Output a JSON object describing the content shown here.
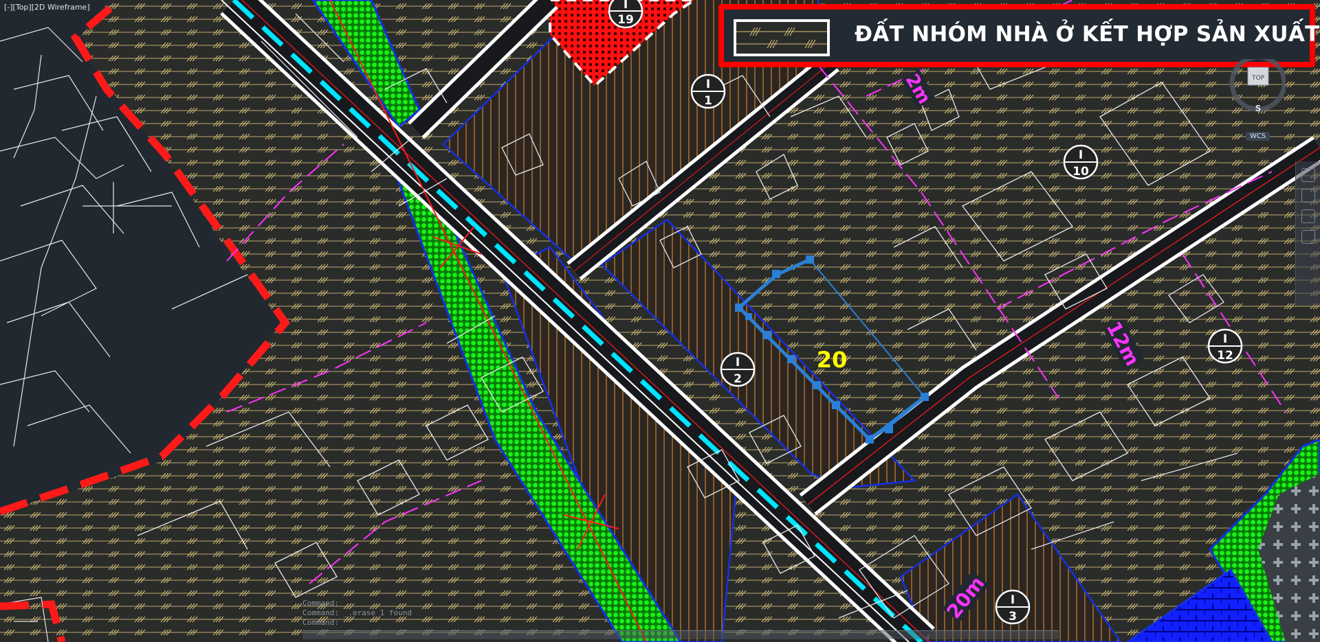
{
  "viewport": {
    "label": "[-][Top][2D Wireframe]"
  },
  "legend": {
    "text": "ĐẤT NHÓM NHÀ Ở KẾT HỢP SẢN XUẤT",
    "border_color": "#ff0000"
  },
  "lot_markers": [
    {
      "top": "I",
      "bottom": "19"
    },
    {
      "top": "I",
      "bottom": "1"
    },
    {
      "top": "I",
      "bottom": "10"
    },
    {
      "top": "I",
      "bottom": "2"
    },
    {
      "top": "I",
      "bottom": "12"
    },
    {
      "top": "I",
      "bottom": "3"
    }
  ],
  "selected_lot": {
    "label": "20",
    "color": "#ffff00"
  },
  "road_labels": [
    "2m",
    "12m",
    "20m"
  ],
  "viewcube": {
    "face": "TOP",
    "compass": "S",
    "wcs": "WCS"
  },
  "command_line": {
    "history": [
      "Command:",
      "Command: _.erase 1 found",
      "Command:"
    ],
    "prompt": ""
  },
  "colors": {
    "background": "#212830",
    "hatch_brown": "#c47a2c",
    "hatch_yellow": "#d9c07a",
    "road": "#ffffff",
    "road_center": "#00e5ff",
    "green_strip": "#0fd40f",
    "boundary_red": "#ff1a1a",
    "dim_magenta": "#ff33ff",
    "lot_blue": "#1530e6",
    "selection_blue": "#2a7fd6"
  }
}
